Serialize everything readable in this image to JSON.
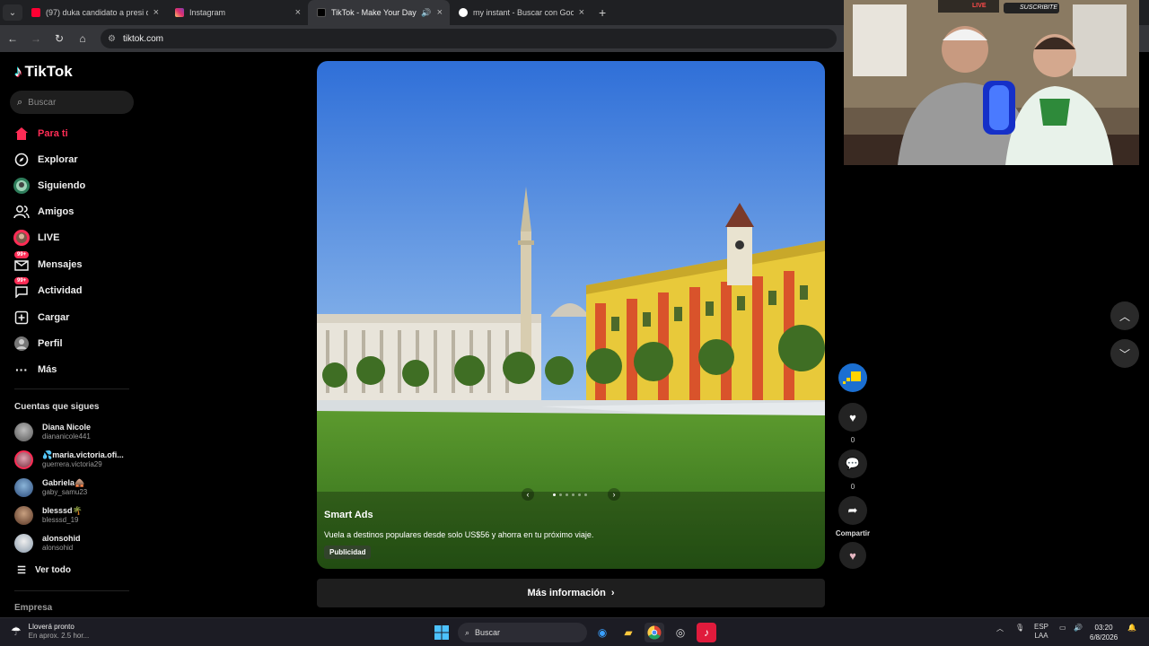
{
  "browser": {
    "tabs": [
      {
        "title": "(97) duka candidato a presi de",
        "favicon": "youtube-icon"
      },
      {
        "title": "Instagram",
        "favicon": "instagram-icon"
      },
      {
        "title": "TikTok - Make Your Day",
        "favicon": "tiktok-icon",
        "active": true
      },
      {
        "title": "my instant - Buscar con Google",
        "favicon": "google-icon"
      }
    ],
    "url": "tiktok.com"
  },
  "sidebar": {
    "brand": "TikTok",
    "search_placeholder": "Buscar",
    "nav": [
      {
        "label": "Para ti",
        "icon": "home-icon",
        "active": true
      },
      {
        "label": "Explorar",
        "icon": "compass-icon"
      },
      {
        "label": "Siguiendo",
        "icon": "following-icon"
      },
      {
        "label": "Amigos",
        "icon": "friends-icon"
      },
      {
        "label": "LIVE",
        "icon": "live-icon"
      },
      {
        "label": "Mensajes",
        "icon": "messages-icon",
        "badge": "99+"
      },
      {
        "label": "Actividad",
        "icon": "activity-icon",
        "badge": "99+"
      },
      {
        "label": "Cargar",
        "icon": "upload-icon"
      },
      {
        "label": "Perfil",
        "icon": "profile-icon"
      },
      {
        "label": "Más",
        "icon": "more-icon"
      }
    ],
    "following_title": "Cuentas que sigues",
    "following": [
      {
        "name": "Diana Nicole",
        "username": "diananicole441"
      },
      {
        "name": "💦maria.victoria.ofi...",
        "username": "guerrera.victoria29"
      },
      {
        "name": "Gabriela🛖",
        "username": "gaby_samu23"
      },
      {
        "name": "blesssd🌴",
        "username": "blesssd_19"
      },
      {
        "name": "alonsohid",
        "username": "alonsohid"
      }
    ],
    "see_all": "Ver todo",
    "company": "Empresa"
  },
  "video": {
    "author": "Smart Ads",
    "caption": "Vuela a destinos populares desde solo US$56 y ahorra en tu próximo viaje.",
    "ad_label": "Publicidad",
    "carousel_count": 6,
    "carousel_active": 1
  },
  "more_info": "Más información",
  "actions": {
    "likes": "0",
    "comments": "0",
    "share": "Compartir"
  },
  "webcam": {
    "overlay_live": "LIVE",
    "overlay_sub": "SUSCRIBITE"
  },
  "taskbar": {
    "weather_title": "Lloverá pronto",
    "weather_sub": "En aprox. 2.5 hor...",
    "search": "Buscar",
    "lang1": "ESP",
    "lang2": "LAA",
    "time": "03:20",
    "date": "6/8/2026"
  }
}
